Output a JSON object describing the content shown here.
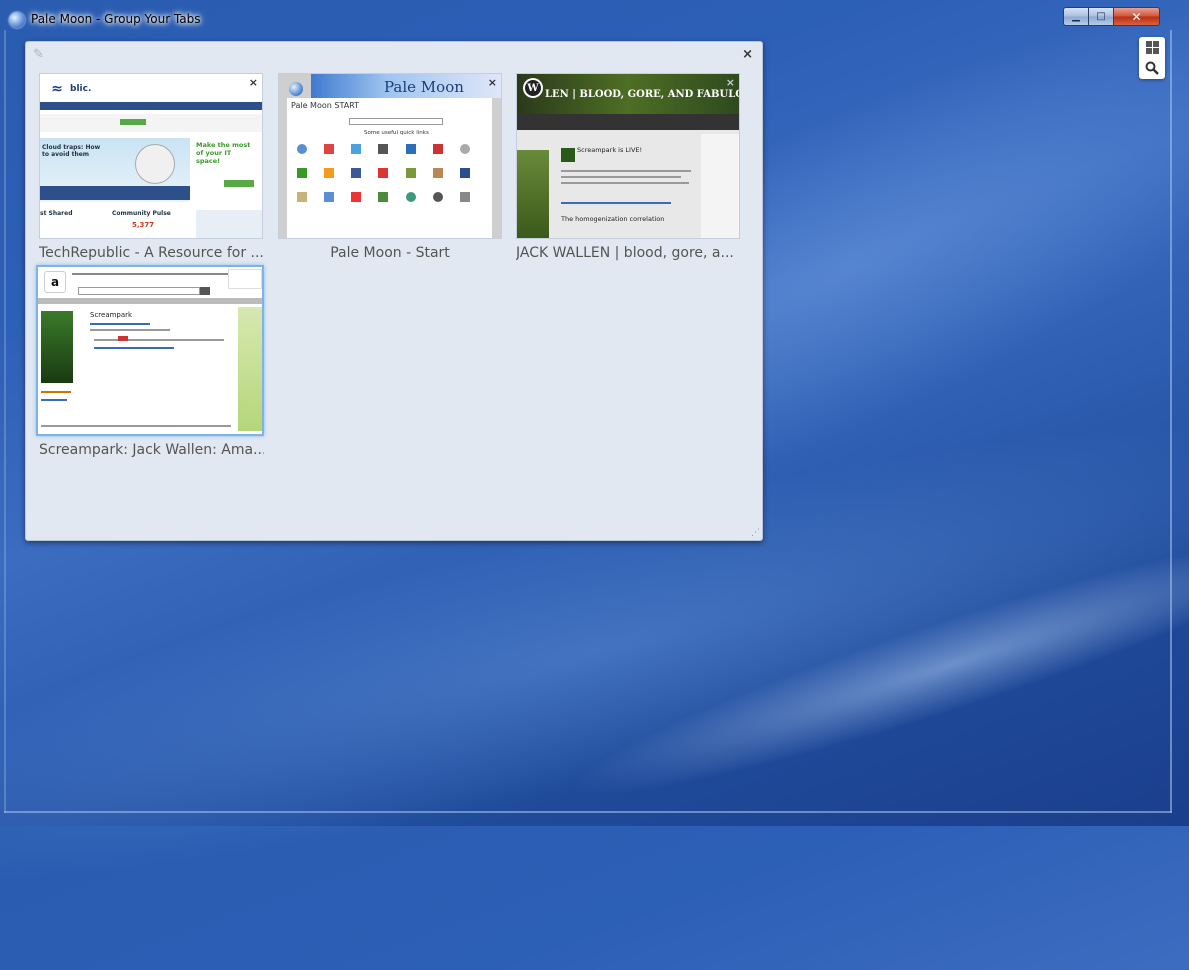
{
  "window": {
    "title": "Pale Moon - Group Your Tabs",
    "minimize_glyph": "▁",
    "maximize_glyph": "□",
    "close_glyph": "✕"
  },
  "group": {
    "edit_glyph": "✎",
    "close_glyph": "×",
    "resize_glyph": "⋰"
  },
  "tabs": [
    {
      "label": "TechRepublic - A Resource for ...",
      "favicon": "techrepublic-icon",
      "selected": false
    },
    {
      "label": "Pale Moon - Start",
      "favicon": "pale-moon-icon",
      "selected": false
    },
    {
      "label": "JACK WALLEN | blood, gore, a...",
      "favicon": "wordpress-icon",
      "selected": false
    },
    {
      "label": "Screampark: Jack Wallen: Ama...",
      "favicon": "amazon-icon",
      "selected": true
    }
  ],
  "thumbs": {
    "techrepublic": {
      "logo": "blic.",
      "headline": "Cloud traps: How to avoid them",
      "promo": "Make the most of your IT space!",
      "shared": "st Shared",
      "pulse": "Community Pulse",
      "count": "5,377"
    },
    "palemoon": {
      "banner": "Pale Moon",
      "heading": "Pale Moon START",
      "subhead": "Some useful quick links"
    },
    "jackwallen": {
      "banner": "LEN | BLOOD, GORE, AND FABULOU",
      "post1": "Screampark is LIVE!",
      "post2": "The homogenization correlation"
    },
    "amazon": {
      "book": "Screampark"
    }
  },
  "tab_close_glyph": "×",
  "colors": {
    "group_bg": "#e1e8f1",
    "selected_border": "#7fb2e6",
    "desktop": "#2c5fb6"
  }
}
